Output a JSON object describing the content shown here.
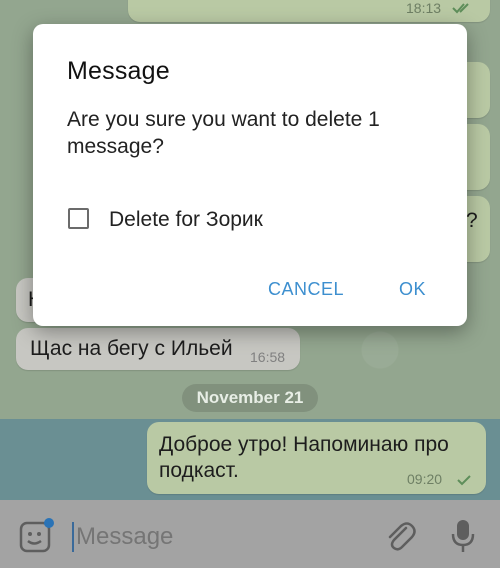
{
  "dialog": {
    "title": "Message",
    "body": "Are you sure you want to delete 1 message?",
    "checkbox_label": "Delete for Зорик",
    "checkbox_checked": false,
    "cancel_label": "CANCEL",
    "ok_label": "OK"
  },
  "chat": {
    "top_message_time": "18:13",
    "partial_message_start": "Н",
    "incoming_message": {
      "text": "Щас на бегу с Ильей",
      "time": "16:58"
    },
    "date_separator": "November 21",
    "outgoing_message": {
      "text": "Доброе утро! Напоминаю про подкаст.",
      "time": "09:20"
    },
    "right_edge_partials": [
      "?"
    ]
  },
  "input": {
    "placeholder": "Message"
  },
  "colors": {
    "accent": "#3d8fcf",
    "dialog_bg": "#ffffff",
    "outgoing_bubble": "#b9c9a4",
    "incoming_bubble": "#c7c7c2"
  }
}
